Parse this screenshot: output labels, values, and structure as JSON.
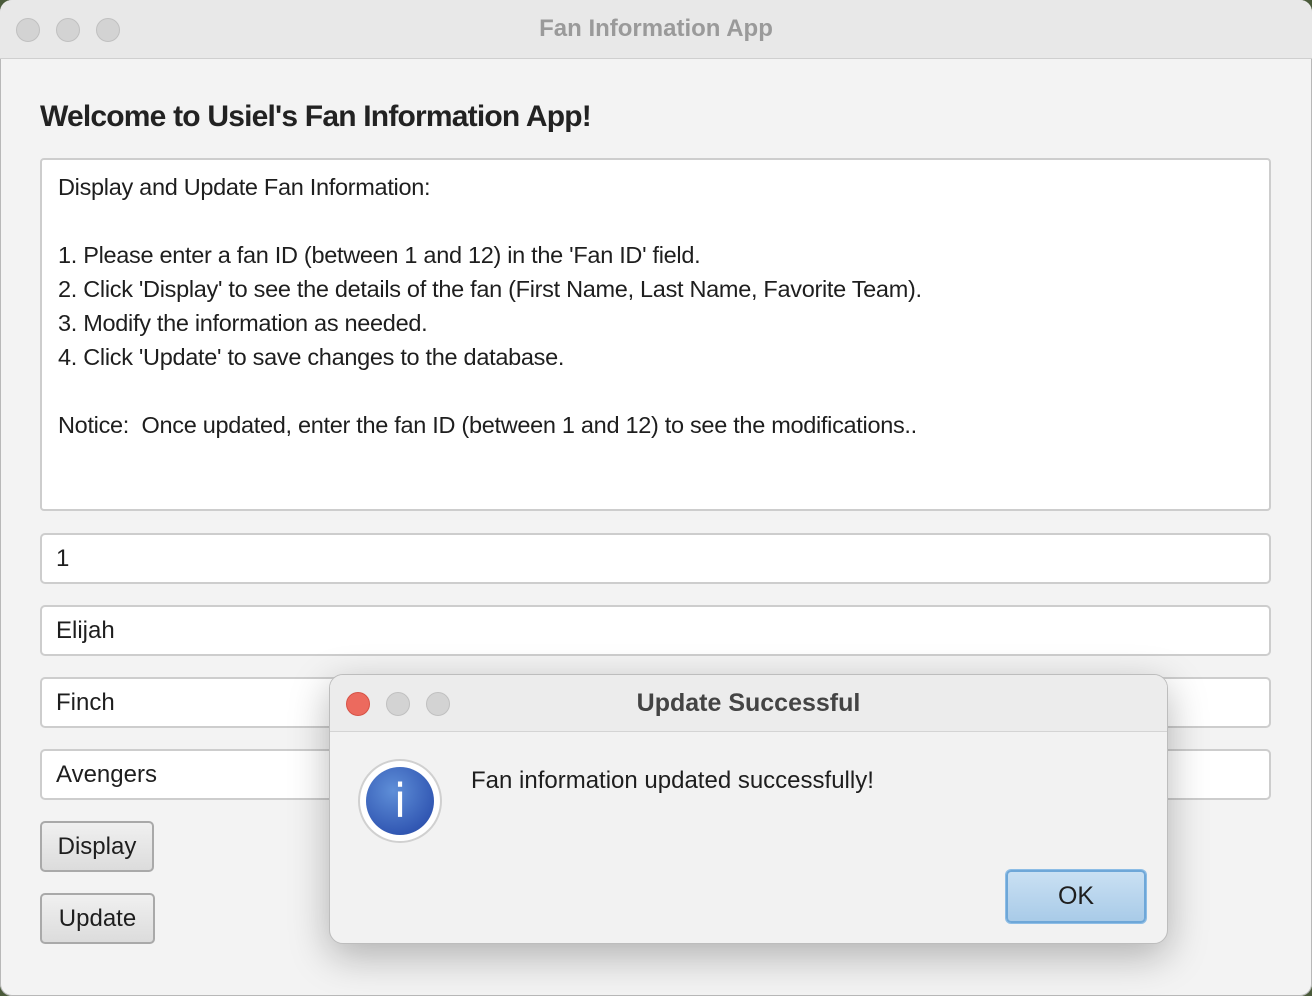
{
  "window": {
    "title": "Fan Information App"
  },
  "main": {
    "heading": "Welcome to Usiel's Fan Information App!",
    "instructions": "Display and Update Fan Information:\n\n1. Please enter a fan ID (between 1 and 12) in the 'Fan ID' field.\n2. Click 'Display' to see the details of the fan (First Name, Last Name, Favorite Team).\n3. Modify the information as needed.\n4. Click 'Update' to save changes to the database.\n\nNotice:  Once updated, enter the fan ID (between 1 and 12) to see the modifications..",
    "fan_id": "1",
    "first_name": "Elijah",
    "last_name": "Finch",
    "favorite_team": "Avengers",
    "display_label": "Display",
    "update_label": "Update"
  },
  "dialog": {
    "title": "Update Successful",
    "icon": "info-icon",
    "icon_glyph": "i",
    "message": "Fan information updated successfully!",
    "ok_label": "OK"
  },
  "colors": {
    "close_red": "#ec6a5e",
    "ok_blue": "#a9cbe8",
    "info_blue": "#3359b4"
  }
}
